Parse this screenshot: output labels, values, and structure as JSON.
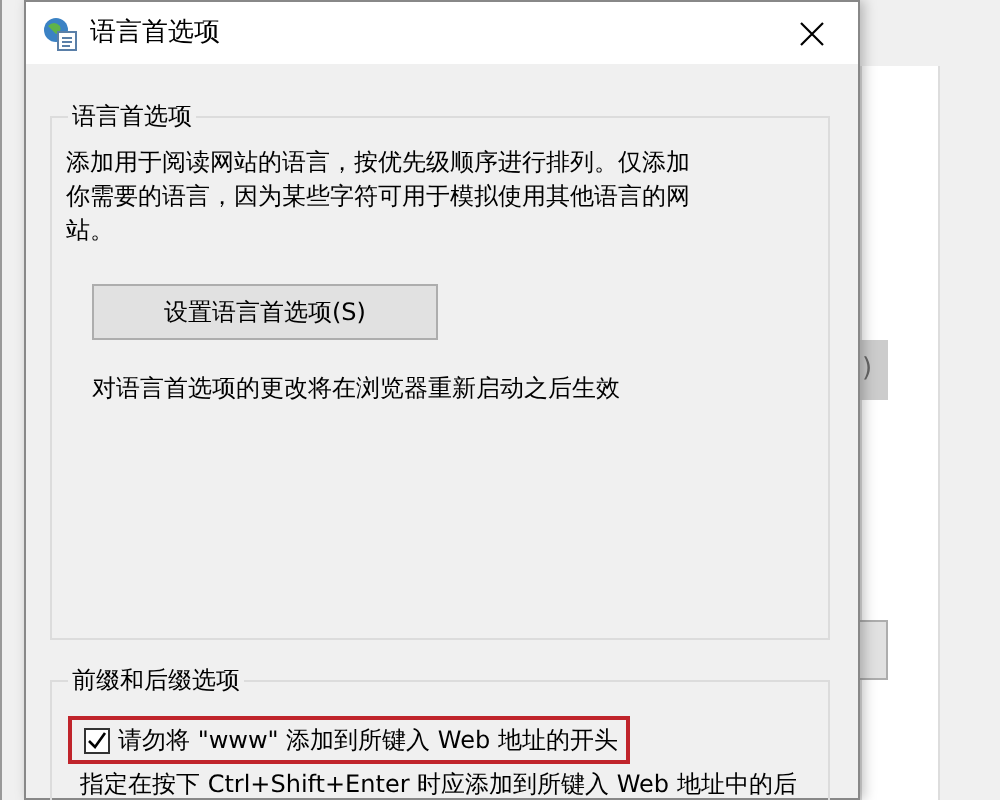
{
  "background_window": {
    "partial_button": ")"
  },
  "dialog": {
    "title": "语言首选项",
    "language_group": {
      "label": "语言首选项",
      "description": "添加用于阅读网站的语言，按优先级顺序进行排列。仅添加你需要的语言，因为某些字符可用于模拟使用其他语言的网站。",
      "button": "设置语言首选项(S)",
      "note": "对语言首选项的更改将在浏览器重新启动之后生效"
    },
    "prefix_group": {
      "label": "前缀和后缀选项",
      "checkbox": {
        "label": "请勿将 \"www\" 添加到所键入 Web 地址的开头",
        "checked": true,
        "highlighted": true
      },
      "description": "指定在按下 Ctrl+Shift+Enter 时应添加到所键入 Web 地址中的后"
    }
  }
}
